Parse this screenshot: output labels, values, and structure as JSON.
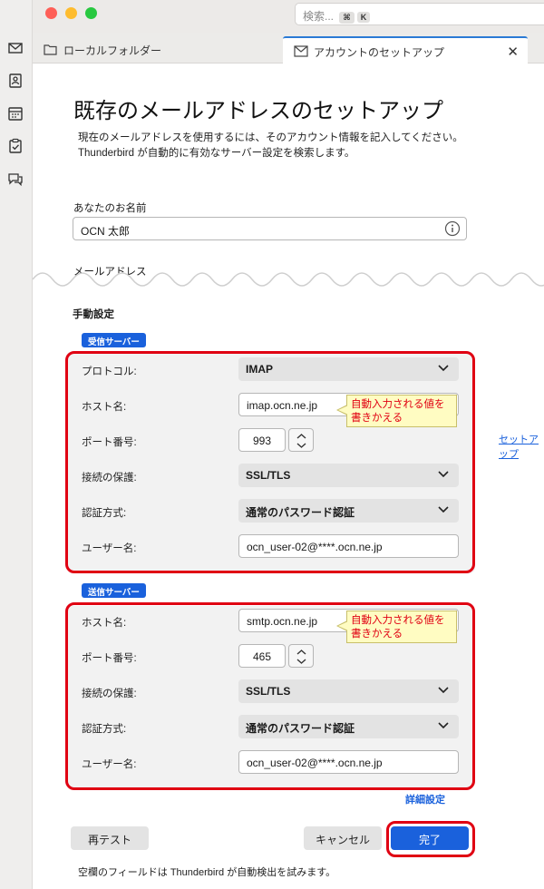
{
  "window": {
    "search_placeholder": "検索...",
    "search_shortcut_keys": [
      "⌘",
      "K"
    ]
  },
  "spaces_toolbar": {
    "icons": [
      "mail-icon",
      "address-book-icon",
      "calendar-icon",
      "tasks-icon",
      "chat-icon"
    ]
  },
  "tabs": [
    {
      "label": "ローカルフォルダー",
      "icon": "folder-icon",
      "active": false
    },
    {
      "label": "アカウントのセットアップ",
      "icon": "mail-icon",
      "active": true
    }
  ],
  "page": {
    "title": "既存のメールアドレスのセットアップ",
    "description_line1": "現在のメールアドレスを使用するには、そのアカウント情報を記入してください。",
    "description_line2": "Thunderbird が自動的に有効なサーバー設定を検索します。",
    "name_label": "あなたのお名前",
    "name_value": "OCN 太郎",
    "email_label": "メールアドレス",
    "manual_heading": "手動設定",
    "setup_link": "セットアップ",
    "advanced_link": "詳細設定",
    "footer_note": "空欄のフィールドは Thunderbird が自動検出を試みます。"
  },
  "incoming": {
    "chip": "受信サーバー",
    "protocol_label": "プロトコル:",
    "protocol_value": "IMAP",
    "host_label": "ホスト名:",
    "host_value": "imap.ocn.ne.jp",
    "port_label": "ポート番号:",
    "port_value": "993",
    "security_label": "接続の保護:",
    "security_value": "SSL/TLS",
    "auth_label": "認証方式:",
    "auth_value": "通常のパスワード認証",
    "user_label": "ユーザー名:",
    "user_value": "ocn_user-02@****.ocn.ne.jp"
  },
  "outgoing": {
    "chip": "送信サーバー",
    "host_label": "ホスト名:",
    "host_value": "smtp.ocn.ne.jp",
    "port_label": "ポート番号:",
    "port_value": "465",
    "security_label": "接続の保護:",
    "security_value": "SSL/TLS",
    "auth_label": "認証方式:",
    "auth_value": "通常のパスワード認証",
    "user_label": "ユーザー名:",
    "user_value": "ocn_user-02@****.ocn.ne.jp"
  },
  "callout": {
    "line1": "自動入力される値を",
    "line2": "書きかえる"
  },
  "buttons": {
    "retest": "再テスト",
    "cancel": "キャンセル",
    "done": "完了"
  },
  "colors": {
    "accent": "#1a61dc",
    "highlight_red": "#e00012",
    "callout_bg": "#fffcc2"
  }
}
